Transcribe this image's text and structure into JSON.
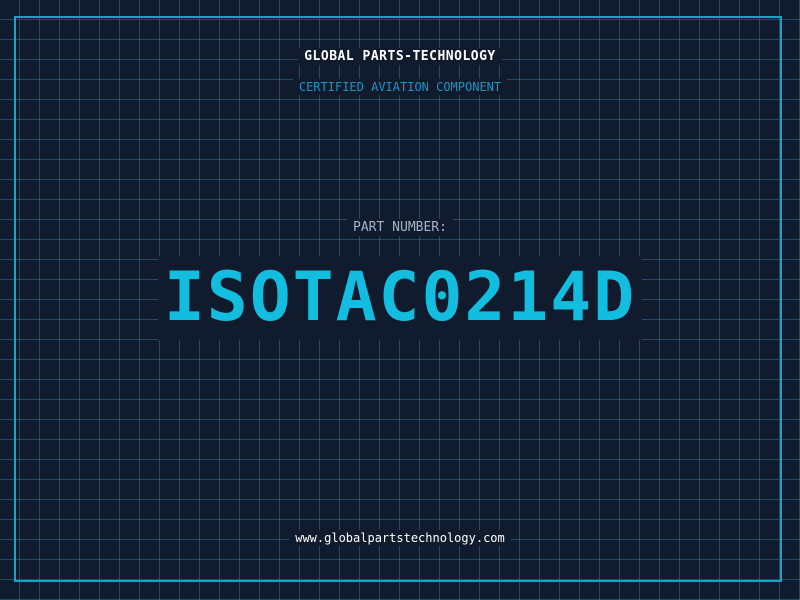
{
  "header": {
    "company_name": "GLOBAL PARTS-TECHNOLOGY",
    "subtitle": "CERTIFIED AVIATION COMPONENT"
  },
  "part": {
    "label": "PART NUMBER:",
    "number": "ISOTAC0214D"
  },
  "footer": {
    "website": "www.globalpartstechnology.com"
  },
  "colors": {
    "background": "#101b2e",
    "grid": "#287896",
    "frame": "#1aa3c8",
    "accent": "#12bde0",
    "subtitle": "#1c95c4",
    "label": "#a9b3c0",
    "text": "#ffffff"
  }
}
